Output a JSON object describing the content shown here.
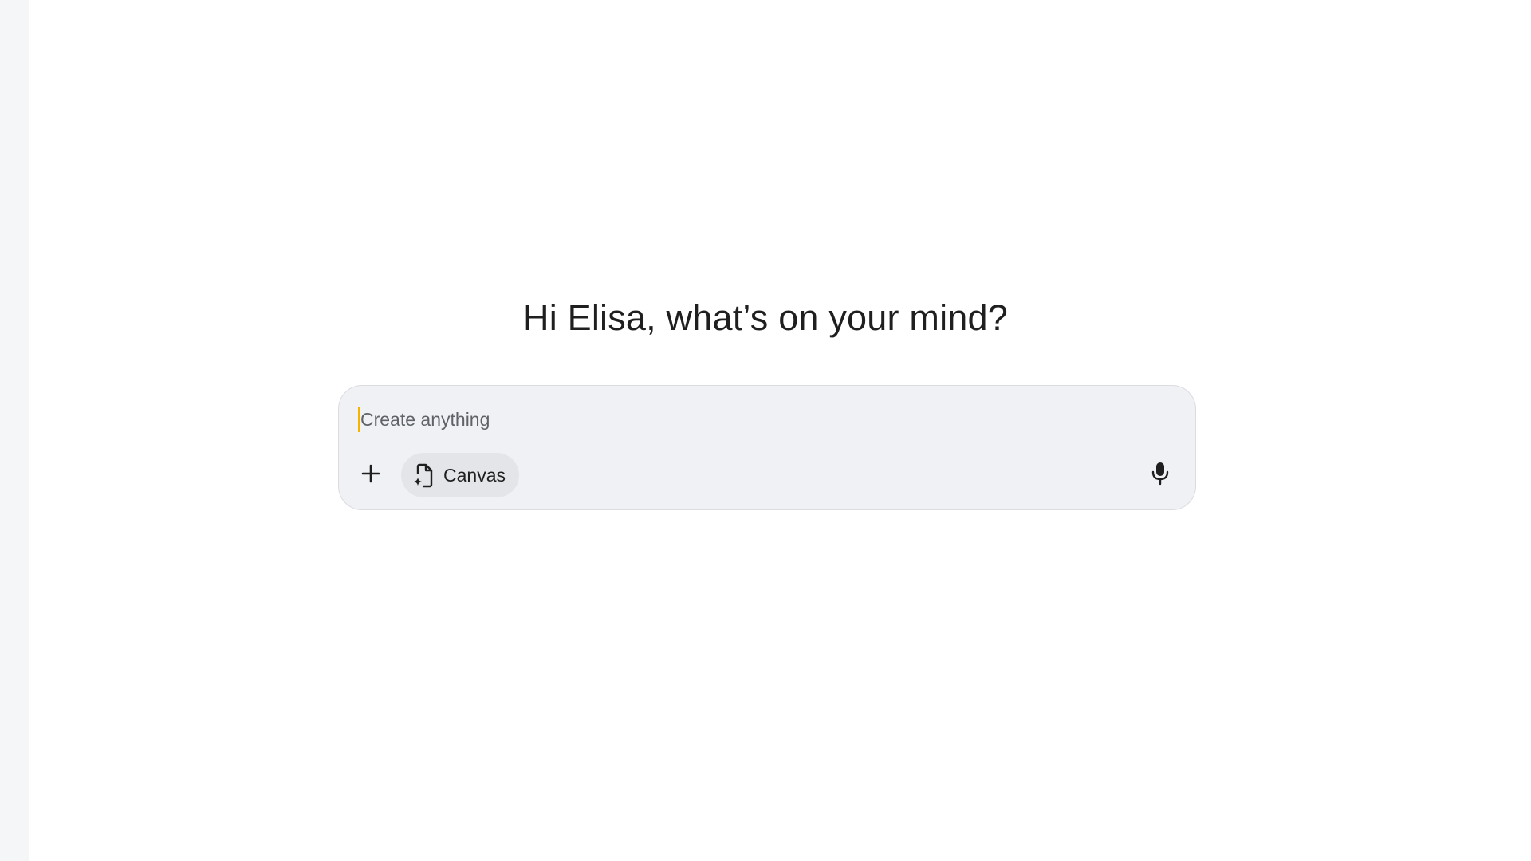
{
  "greeting": {
    "text": "Hi Elisa, what’s on your mind?"
  },
  "composer": {
    "placeholder": "Create anything",
    "value": "",
    "caret_color": "#f4b400"
  },
  "toolbar": {
    "add_icon": "plus-icon",
    "canvas_label": "Canvas",
    "canvas_icon": "canvas-document-sparkle-icon",
    "mic_icon": "microphone-icon"
  },
  "colors": {
    "composer_bg": "#f0f1f5",
    "chip_bg": "#e3e5e9",
    "sidebar_bg": "#f5f6f8",
    "text": "#1f1f1f"
  }
}
